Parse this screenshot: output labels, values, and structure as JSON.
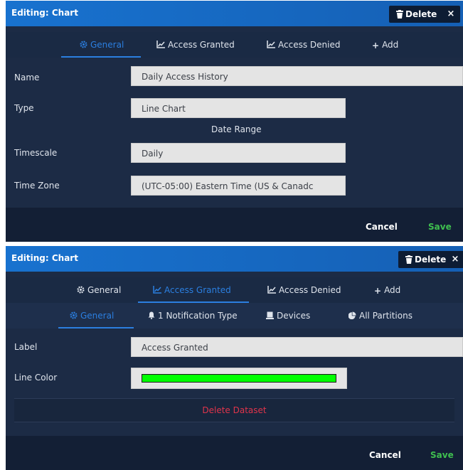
{
  "dialog1": {
    "title": "Editing: Chart",
    "delete_label": "Delete",
    "close_label": "×",
    "tabs": [
      {
        "label": "General",
        "icon": "gear-icon",
        "active": true
      },
      {
        "label": "Access Granted",
        "icon": "line-chart-icon",
        "active": false
      },
      {
        "label": "Access Denied",
        "icon": "line-chart-icon",
        "active": false
      },
      {
        "label": "Add",
        "icon": "plus-icon",
        "active": false
      }
    ],
    "fields": {
      "name_label": "Name",
      "name_value": "Daily Access History",
      "type_label": "Type",
      "type_value": "Line Chart",
      "section_label": "Date Range",
      "timescale_label": "Timescale",
      "timescale_value": "Daily",
      "timezone_label": "Time Zone",
      "timezone_value": "(UTC-05:00) Eastern Time (US & Canadc"
    },
    "cancel_label": "Cancel",
    "save_label": "Save"
  },
  "dialog2": {
    "title": "Editing: Chart",
    "delete_label": "Delete",
    "close_label": "×",
    "tabs": [
      {
        "label": "General",
        "icon": "gear-icon",
        "active": false
      },
      {
        "label": "Access Granted",
        "icon": "line-chart-icon",
        "active": true
      },
      {
        "label": "Access Denied",
        "icon": "line-chart-icon",
        "active": false
      },
      {
        "label": "Add",
        "icon": "plus-icon",
        "active": false
      }
    ],
    "subtabs": [
      {
        "label": "General",
        "icon": "gear-icon",
        "active": true
      },
      {
        "label": "1 Notification Type",
        "icon": "bell-icon",
        "active": false
      },
      {
        "label": "Devices",
        "icon": "device-icon",
        "active": false
      },
      {
        "label": "All Partitions",
        "icon": "partition-icon",
        "active": false
      }
    ],
    "fields": {
      "label_label": "Label",
      "label_value": "Access Granted",
      "color_label": "Line Color",
      "color_value": "#00ff00"
    },
    "delete_dataset_label": "Delete Dataset",
    "cancel_label": "Cancel",
    "save_label": "Save"
  },
  "colors": {
    "accent": "#2b7fe0",
    "save": "#3fbf4f",
    "danger": "#e0344b",
    "panel": "#1c2b45"
  }
}
